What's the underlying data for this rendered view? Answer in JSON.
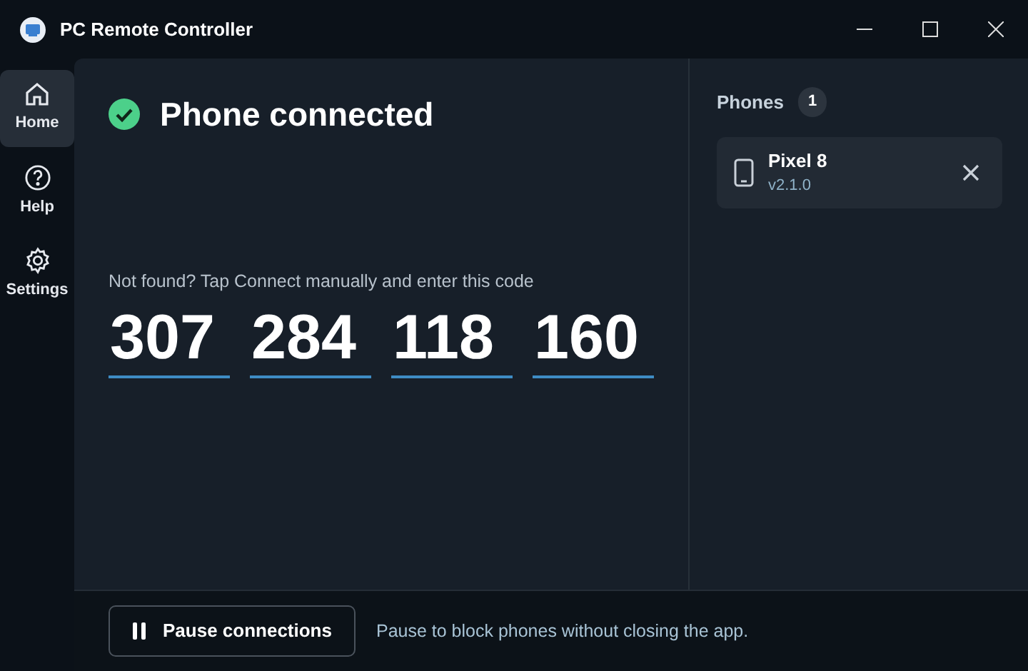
{
  "window": {
    "title": "PC Remote Controller"
  },
  "sidebar": {
    "items": [
      {
        "kind": "home",
        "label": "Home",
        "selected": true
      },
      {
        "kind": "help",
        "label": "Help",
        "selected": false
      },
      {
        "kind": "settings",
        "label": "Settings",
        "selected": false
      }
    ]
  },
  "status": {
    "text": "Phone connected",
    "connected": true
  },
  "code": {
    "hint": "Not found? Tap Connect manually and enter this code",
    "groups": [
      "307",
      "284",
      "118",
      "160"
    ]
  },
  "phones": {
    "title": "Phones",
    "count": "1",
    "devices": [
      {
        "name": "Pixel 8",
        "version": "v2.1.0"
      }
    ]
  },
  "footer": {
    "button": "Pause connections",
    "hint": "Pause to block phones without closing the app."
  }
}
